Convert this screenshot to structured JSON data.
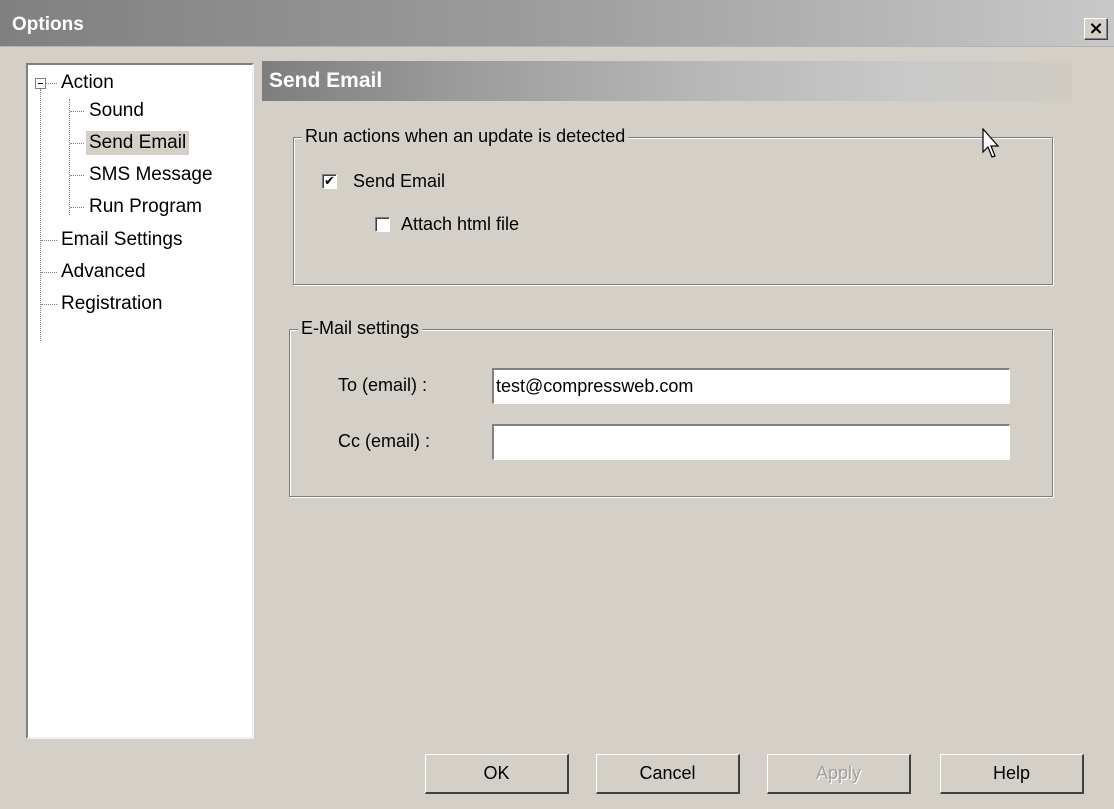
{
  "window": {
    "title": "Options",
    "close_symbol": "×"
  },
  "tree": {
    "items": [
      {
        "label": "Action",
        "expanded": true
      },
      {
        "label": "Sound"
      },
      {
        "label": "Send Email",
        "selected": true
      },
      {
        "label": "SMS Message"
      },
      {
        "label": "Run Program"
      },
      {
        "label": "Email Settings"
      },
      {
        "label": "Advanced"
      },
      {
        "label": "Registration"
      }
    ]
  },
  "panel": {
    "title": "Send Email"
  },
  "run_actions": {
    "legend": "Run actions when an update is detected",
    "send_email": {
      "label": "Send Email",
      "checked": true,
      "mark": "✔"
    },
    "attach_html": {
      "label": "Attach html file",
      "checked": false
    }
  },
  "email_settings": {
    "legend": "E-Mail settings",
    "to_label": "To (email) :",
    "to_value": "test@compressweb.com",
    "cc_label": "Cc (email) :",
    "cc_value": ""
  },
  "buttons": {
    "ok": "OK",
    "cancel": "Cancel",
    "apply": "Apply",
    "help": "Help"
  }
}
